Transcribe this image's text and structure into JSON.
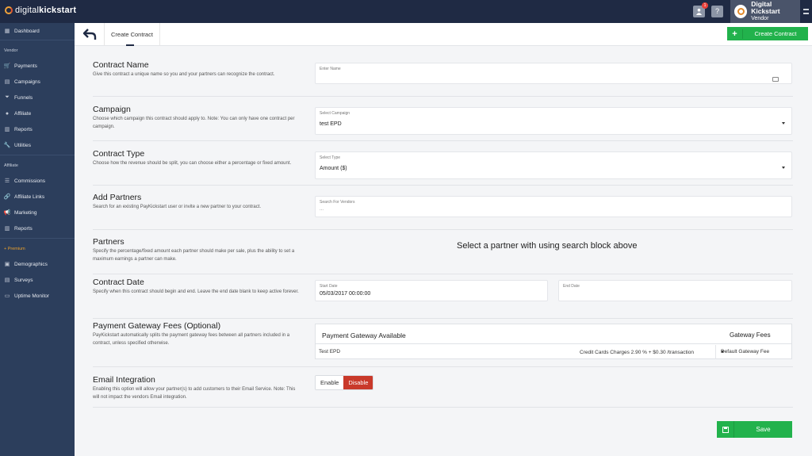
{
  "brand": {
    "logo_plain": "digital",
    "logo_bold": "kickstart"
  },
  "topbar": {
    "notification_count": "1",
    "help_label": "?",
    "user_name": "Digital Kickstart",
    "user_role": "Vendor"
  },
  "sidebar": {
    "dashboard": "Dashboard",
    "section_vendor": "Vendor",
    "vendor_items": [
      "Payments",
      "Campaigns",
      "Funnels",
      "Affiliate",
      "Reports",
      "Utilities"
    ],
    "section_affiliate": "Affiliate",
    "affiliate_items": [
      "Commissions",
      "Affiliate Links",
      "Marketing",
      "Reports"
    ],
    "section_premium": "+ Premium",
    "premium_items": [
      "Demographics",
      "Surveys",
      "Uptime Monitor"
    ]
  },
  "subheader": {
    "tab_label": "Create Contract",
    "create_button": "Create Contract"
  },
  "form": {
    "contract_name": {
      "title": "Contract Name",
      "desc": "Give this contract a unique name so you and your partners can recognize the contract.",
      "label": "Enter Name",
      "value": ""
    },
    "campaign": {
      "title": "Campaign",
      "desc": "Choose which campaign this contract should apply to. Note: You can only have one contract per campaign.",
      "label": "Select Campaign",
      "value": "test EPD"
    },
    "contract_type": {
      "title": "Contract Type",
      "desc": "Choose how the revenue should be split, you can choose either a percentage or fixed amount.",
      "label": "Select Type",
      "value": "Amount ($)"
    },
    "add_partners": {
      "title": "Add Partners",
      "desc": "Search for an existing PayKickstart user or invite a new partner to your contract.",
      "label": "Search For Vendors",
      "value": "..."
    },
    "partners": {
      "title": "Partners",
      "desc": "Specify the percentage/fixed amount each partner should make per sale, plus the ability to set a maximum earnings a partner can make.",
      "message": "Select a partner with using search block above"
    },
    "contract_date": {
      "title": "Contract Date",
      "desc": "Specify when this contract should begin and end. Leave the end date blank to keep active forever.",
      "start_label": "Start Date",
      "start_value": "05/03/2017 00:00:00",
      "end_label": "End Date",
      "end_value": ""
    },
    "gateway_fees": {
      "title": "Payment Gateway Fees (Optional)",
      "desc": "PayKickstart automatically splits the payment gateway fees between all partners included in a contract, unless specified otherwise.",
      "col_gateway": "Payment Gateway Available",
      "col_fees": "Gateway Fees",
      "row_name": "Test EPD",
      "row_charges": "Credit Cards Charges 2.90 % + $0.30 /transaction",
      "row_select": "Default Gateway Fee"
    },
    "email_integration": {
      "title": "Email Integration",
      "desc": "Enabling this option will allow your partner(s) to add customers to their Email Service. Note: This will not impact the vendors Email integration.",
      "enable": "Enable",
      "disable": "Disable"
    }
  },
  "save_button": "Save",
  "colors": {
    "topbar": "#1f2a44",
    "sidebar": "#2c3e5c",
    "accent_green": "#22b24c",
    "disable_red": "#c9392a",
    "premium": "#e9a02c"
  }
}
